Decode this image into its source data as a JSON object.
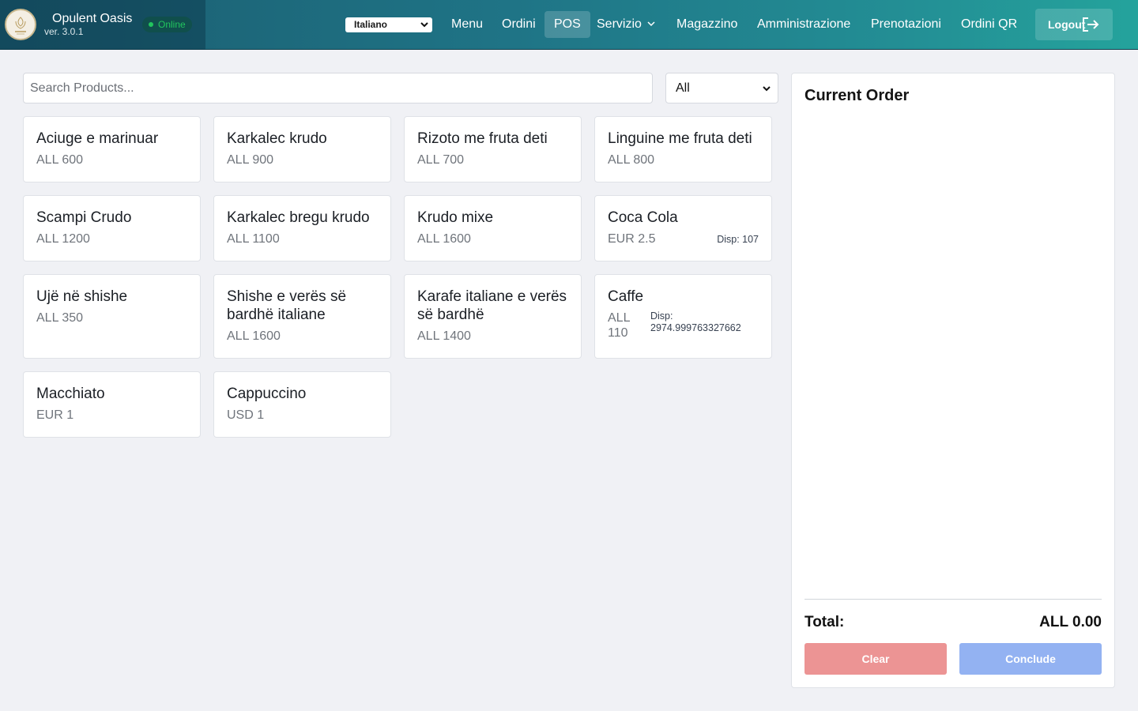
{
  "brand": {
    "name": "Opulent Oasis",
    "version": "ver. 3.0.1",
    "status": "Online"
  },
  "header": {
    "language": "Italiano",
    "nav": [
      "Menu",
      "Ordini",
      "POS",
      "Servizio",
      "Magazzino",
      "Amministrazione",
      "Prenotazioni",
      "Ordini QR"
    ],
    "active_nav": "POS",
    "logout_label": "Logout"
  },
  "search": {
    "placeholder": "Search Products...",
    "value": ""
  },
  "filter": {
    "selected": "All"
  },
  "products": [
    {
      "name": "Aciuge e marinuar",
      "price": "ALL 600"
    },
    {
      "name": "Karkalec krudo",
      "price": "ALL 900"
    },
    {
      "name": "Rizoto me fruta deti",
      "price": "ALL 700"
    },
    {
      "name": "Linguine me fruta deti",
      "price": "ALL 800"
    },
    {
      "name": "Scampi Crudo",
      "price": "ALL 1200"
    },
    {
      "name": "Karkalec bregu krudo",
      "price": "ALL 1100"
    },
    {
      "name": "Krudo mixe",
      "price": "ALL 1600"
    },
    {
      "name": "Coca Cola",
      "price": "EUR 2.5",
      "disp": "Disp: 107"
    },
    {
      "name": "Ujë në shishe",
      "price": "ALL 350"
    },
    {
      "name": "Shishe e verës së bardhë italiane",
      "price": "ALL 1600"
    },
    {
      "name": "Karafe italiane e verës së bardhë",
      "price": "ALL 1400"
    },
    {
      "name": "Caffe",
      "price": "ALL 110",
      "disp": "Disp: 2974.999763327662"
    },
    {
      "name": "Macchiato",
      "price": "EUR 1"
    },
    {
      "name": "Cappuccino",
      "price": "USD 1"
    }
  ],
  "order": {
    "title": "Current Order",
    "total_label": "Total:",
    "total_value": "ALL 0.00",
    "clear_label": "Clear",
    "conclude_label": "Conclude"
  },
  "colors": {
    "header_start": "#1b5d70",
    "header_end": "#24a39c",
    "online": "#22c55e",
    "clear_button": "#ec9494",
    "conclude_button": "#93b2f2"
  }
}
